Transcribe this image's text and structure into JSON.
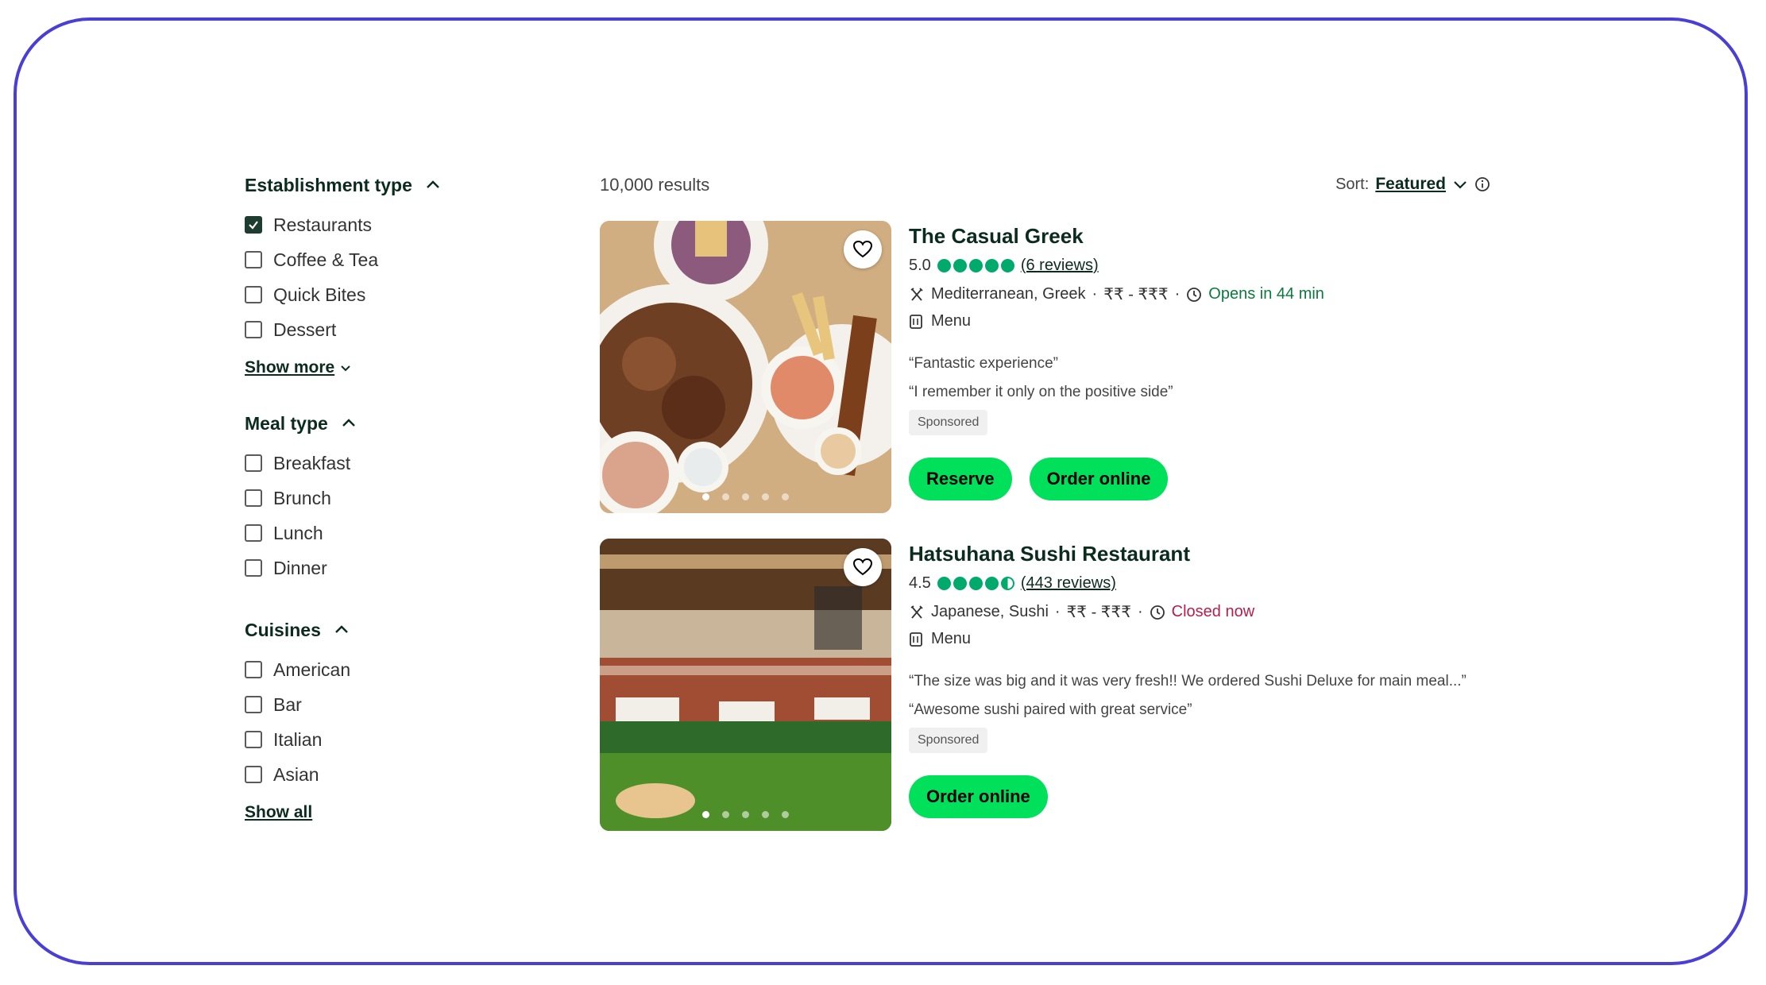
{
  "sidebar": {
    "establishment": {
      "title": "Establishment type",
      "options": [
        {
          "label": "Restaurants",
          "checked": true
        },
        {
          "label": "Coffee & Tea",
          "checked": false
        },
        {
          "label": "Quick Bites",
          "checked": false
        },
        {
          "label": "Dessert",
          "checked": false
        }
      ],
      "more_label": "Show more"
    },
    "meal": {
      "title": "Meal type",
      "options": [
        {
          "label": "Breakfast",
          "checked": false
        },
        {
          "label": "Brunch",
          "checked": false
        },
        {
          "label": "Lunch",
          "checked": false
        },
        {
          "label": "Dinner",
          "checked": false
        }
      ]
    },
    "cuisines": {
      "title": "Cuisines",
      "options": [
        {
          "label": "American",
          "checked": false
        },
        {
          "label": "Bar",
          "checked": false
        },
        {
          "label": "Italian",
          "checked": false
        },
        {
          "label": "Asian",
          "checked": false
        }
      ],
      "more_label": "Show all"
    }
  },
  "results": {
    "count": "10,000 results",
    "sort_label": "Sort:",
    "sort_value": "Featured"
  },
  "restaurants": [
    {
      "name": "The Casual Greek",
      "rating": "5.0",
      "rating_value": 5.0,
      "reviews": "(6 reviews)",
      "cuisine": "Mediterranean, Greek",
      "price": "₹₹ - ₹₹₹",
      "status": "Opens in 44 min",
      "menu": "Menu",
      "quote1": "“Fantastic experience”",
      "quote2": "“I remember it only on the positive side”",
      "badge": "Sponsored",
      "btn_reserve": "Reserve",
      "btn_order": "Order online"
    },
    {
      "name": "Hatsuhana Sushi Restaurant",
      "rating": "4.5",
      "rating_value": 4.5,
      "reviews": "(443 reviews)",
      "cuisine": "Japanese, Sushi",
      "price": "₹₹ - ₹₹₹",
      "status": "Closed now",
      "menu": "Menu",
      "quote1": "“The size was big and it was very fresh!! We ordered Sushi Deluxe for main meal...”",
      "quote2": "“Awesome sushi paired with great service”",
      "badge": "Sponsored",
      "btn_order": "Order online"
    }
  ],
  "colors": {
    "frame": "#4a3fd4",
    "accent_green": "#00e05a",
    "bubble_green": "#00aa6c",
    "open_text": "#0b7a3e",
    "closed_text": "#b31f4a",
    "heading": "#0b2b1f"
  }
}
